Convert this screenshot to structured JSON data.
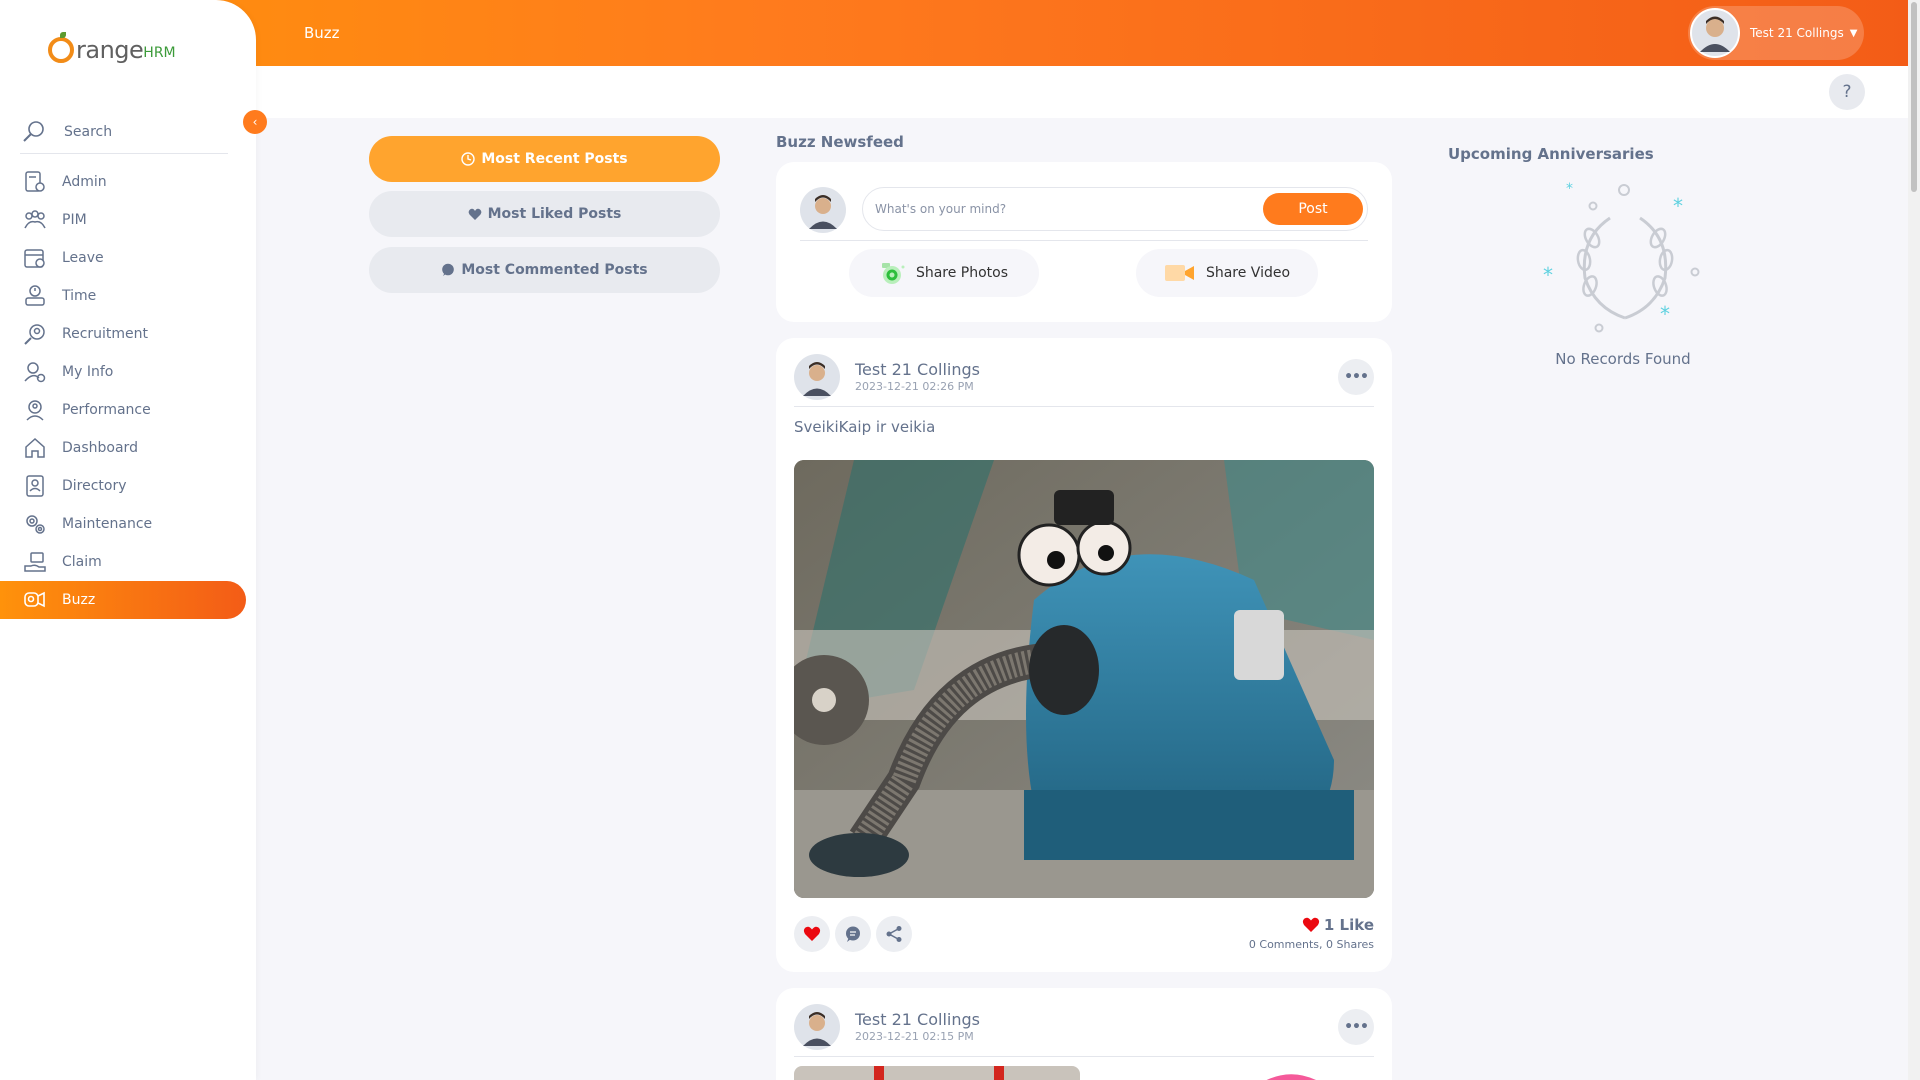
{
  "header": {
    "title": "Buzz"
  },
  "user": {
    "name": "Test 21 Collings"
  },
  "brand": {
    "name_main": "range",
    "name_suffix": "HRM"
  },
  "sidebar": {
    "search_label": "Search",
    "items": [
      {
        "label": "Admin",
        "icon": "admin-icon"
      },
      {
        "label": "PIM",
        "icon": "pim-icon"
      },
      {
        "label": "Leave",
        "icon": "leave-icon"
      },
      {
        "label": "Time",
        "icon": "time-icon"
      },
      {
        "label": "Recruitment",
        "icon": "recruitment-icon"
      },
      {
        "label": "My Info",
        "icon": "my-info-icon"
      },
      {
        "label": "Performance",
        "icon": "performance-icon"
      },
      {
        "label": "Dashboard",
        "icon": "dashboard-icon"
      },
      {
        "label": "Directory",
        "icon": "directory-icon"
      },
      {
        "label": "Maintenance",
        "icon": "maintenance-icon"
      },
      {
        "label": "Claim",
        "icon": "claim-icon"
      },
      {
        "label": "Buzz",
        "icon": "buzz-icon",
        "active": true
      }
    ]
  },
  "help": {
    "label": "?"
  },
  "filters": {
    "recent": "Most Recent Posts",
    "liked": "Most Liked Posts",
    "commented": "Most Commented Posts"
  },
  "newsfeed": {
    "title": "Buzz Newsfeed",
    "compose": {
      "placeholder": "What's on your mind?",
      "post_button": "Post",
      "share_photos": "Share Photos",
      "share_video": "Share Video"
    },
    "posts": [
      {
        "author": "Test 21 Collings",
        "time": "2023-12-21 02:26 PM",
        "text": "SveikiKaip ir veikia",
        "likes": "1 Like",
        "comments": "0 Comments",
        "separator": ",",
        "shares": "0 Shares"
      },
      {
        "author": "Test 21 Collings",
        "time": "2023-12-21 02:15 PM"
      }
    ]
  },
  "anniversaries": {
    "title": "Upcoming Anniversaries",
    "empty": "No Records Found"
  },
  "colors": {
    "accent": "#ff7b1d",
    "accent_light": "#ffa42e",
    "text": "#64728c"
  }
}
